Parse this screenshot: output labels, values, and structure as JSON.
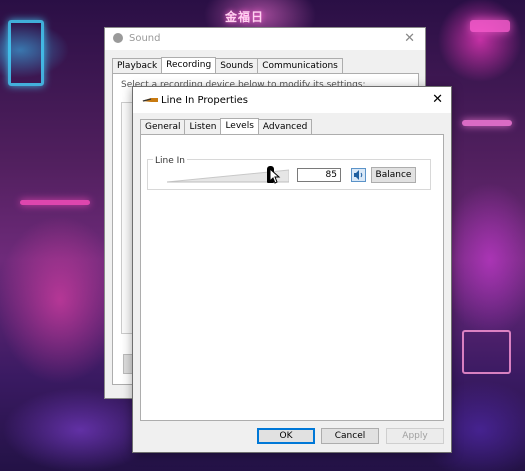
{
  "background": {
    "neon_sign_text": "金福日"
  },
  "sound_window": {
    "title": "Sound",
    "tabs": [
      {
        "label": "Playback"
      },
      {
        "label": "Recording"
      },
      {
        "label": "Sounds"
      },
      {
        "label": "Communications"
      }
    ],
    "active_tab": "Recording",
    "hint_text": "Select a recording device below to modify its settings:"
  },
  "dialog": {
    "title": "Line In Properties",
    "tabs": [
      {
        "label": "General"
      },
      {
        "label": "Listen"
      },
      {
        "label": "Levels"
      },
      {
        "label": "Advanced"
      }
    ],
    "active_tab": "Levels",
    "levels": {
      "group_label": "Line In",
      "level_value": "85",
      "slider_fraction": 0.85,
      "muted": false,
      "balance_label": "Balance"
    },
    "buttons": {
      "ok": "OK",
      "cancel": "Cancel",
      "apply": "Apply"
    }
  },
  "colors": {
    "accent": "#0078d7",
    "mute_button_bg": "#d9e8f7"
  },
  "icons": {
    "sound_window_icon": "speaker-icon",
    "dialog_icon": "line-in-jack-icon",
    "mute_icon": "speaker-volume-icon",
    "cursor": "arrow-cursor-icon"
  }
}
